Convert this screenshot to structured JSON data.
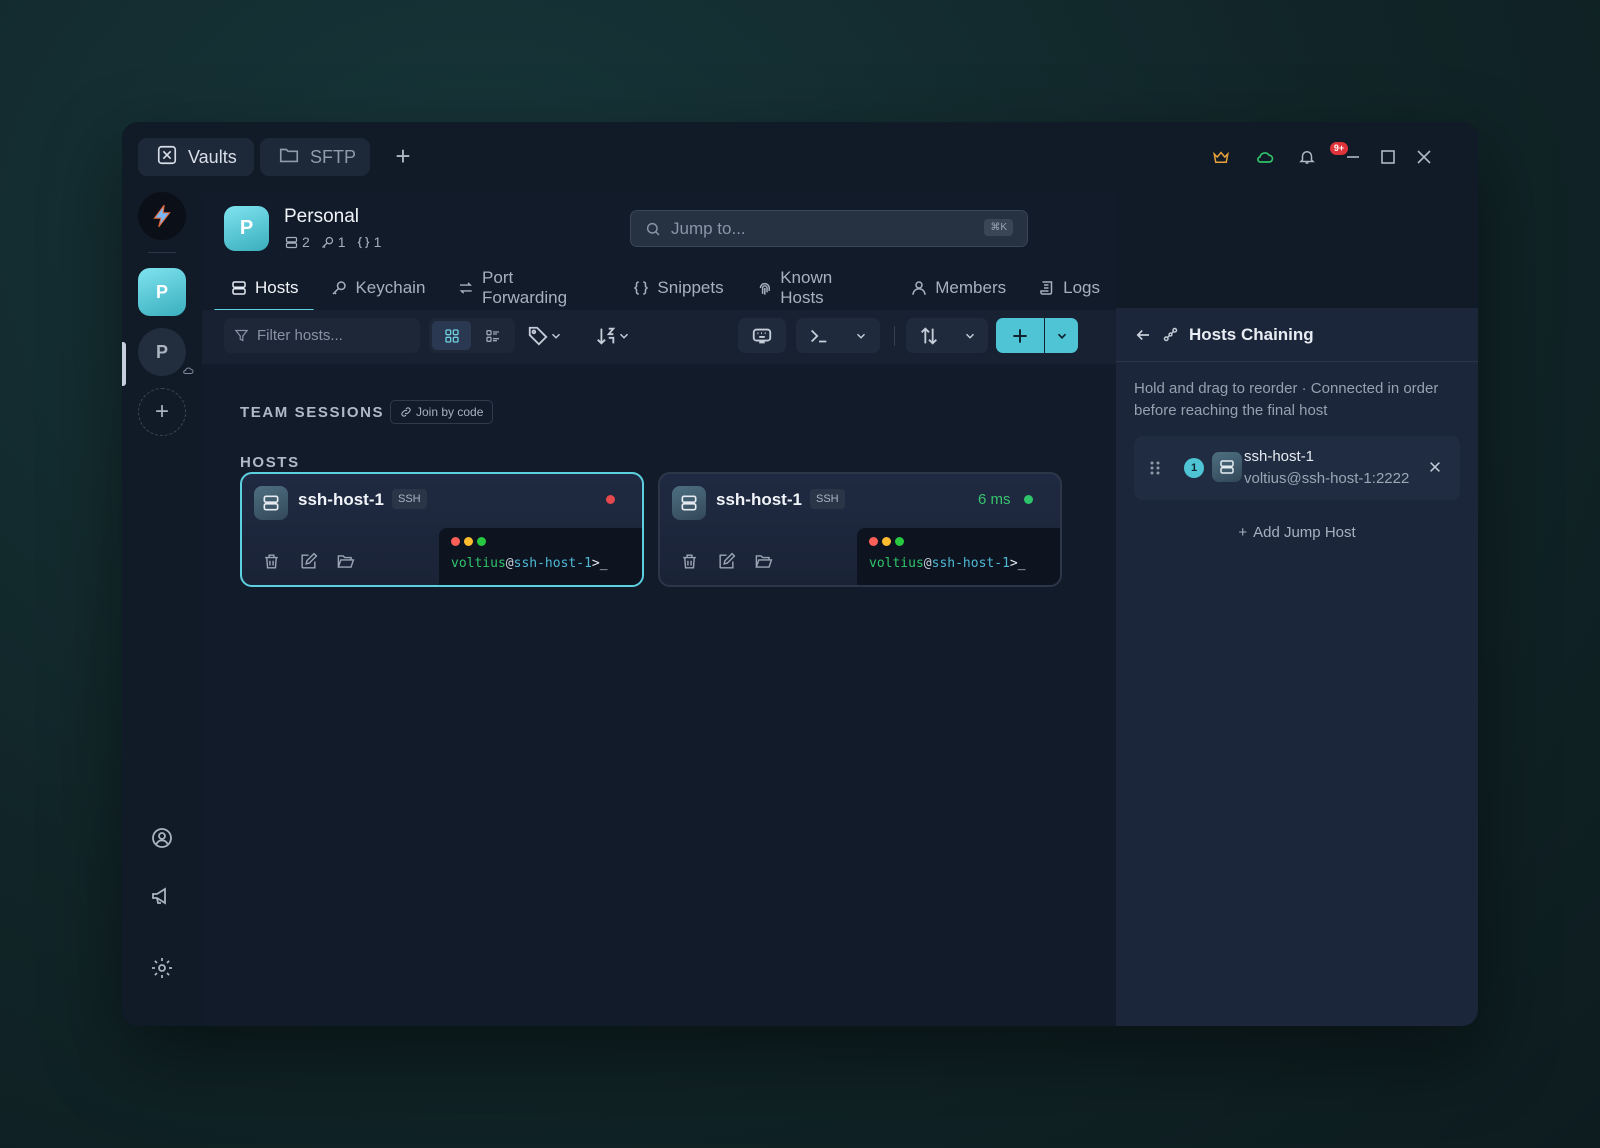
{
  "tabs": [
    {
      "label": "Vaults"
    },
    {
      "label": "SFTP"
    }
  ],
  "notifications": {
    "count": "9+"
  },
  "rail": {
    "vault_active_initial": "P",
    "vault_other_initial": "P",
    "add": "+"
  },
  "vault": {
    "initial": "P",
    "name": "Personal",
    "hosts_count": "2",
    "keys_count": "1",
    "snippets_count": "1"
  },
  "search": {
    "placeholder": "Jump to...",
    "shortcut": "⌘K"
  },
  "nav": [
    {
      "label": "Hosts",
      "icon": "server-icon"
    },
    {
      "label": "Keychain",
      "icon": "key-icon"
    },
    {
      "label": "Port Forwarding",
      "icon": "arrows-icon"
    },
    {
      "label": "Snippets",
      "icon": "braces-icon"
    },
    {
      "label": "Known Hosts",
      "icon": "fingerprint-icon"
    },
    {
      "label": "Members",
      "icon": "user-icon"
    },
    {
      "label": "Logs",
      "icon": "scroll-icon"
    }
  ],
  "toolbar": {
    "filter_placeholder": "Filter hosts..."
  },
  "sections": {
    "team_sessions": "TEAM SESSIONS",
    "join_by_code": "Join by code",
    "hosts": "HOSTS"
  },
  "hosts": [
    {
      "name": "ssh-host-1",
      "protocol": "SSH",
      "status": "offline",
      "status_color": "#e5484d",
      "latency": "",
      "user": "voltius",
      "host": "ssh-host-1",
      "prompt_tail": ">_"
    },
    {
      "name": "ssh-host-1",
      "protocol": "SSH",
      "status": "online",
      "status_color": "#30c46a",
      "latency": "6 ms",
      "user": "voltius",
      "host": "ssh-host-1",
      "prompt_tail": ">_"
    }
  ],
  "chaining": {
    "title": "Hosts Chaining",
    "description": "Hold and drag to reorder · Connected in order before reaching the final host",
    "jump_hosts": [
      {
        "order": "1",
        "name": "ssh-host-1",
        "address": "voltius@ssh-host-1:2222"
      }
    ],
    "add_label": "Add Jump Host"
  },
  "colors": {
    "accent": "#5dd0e0",
    "primary_button": "#4fc4d4",
    "online": "#30c46a",
    "offline": "#e5484d"
  }
}
